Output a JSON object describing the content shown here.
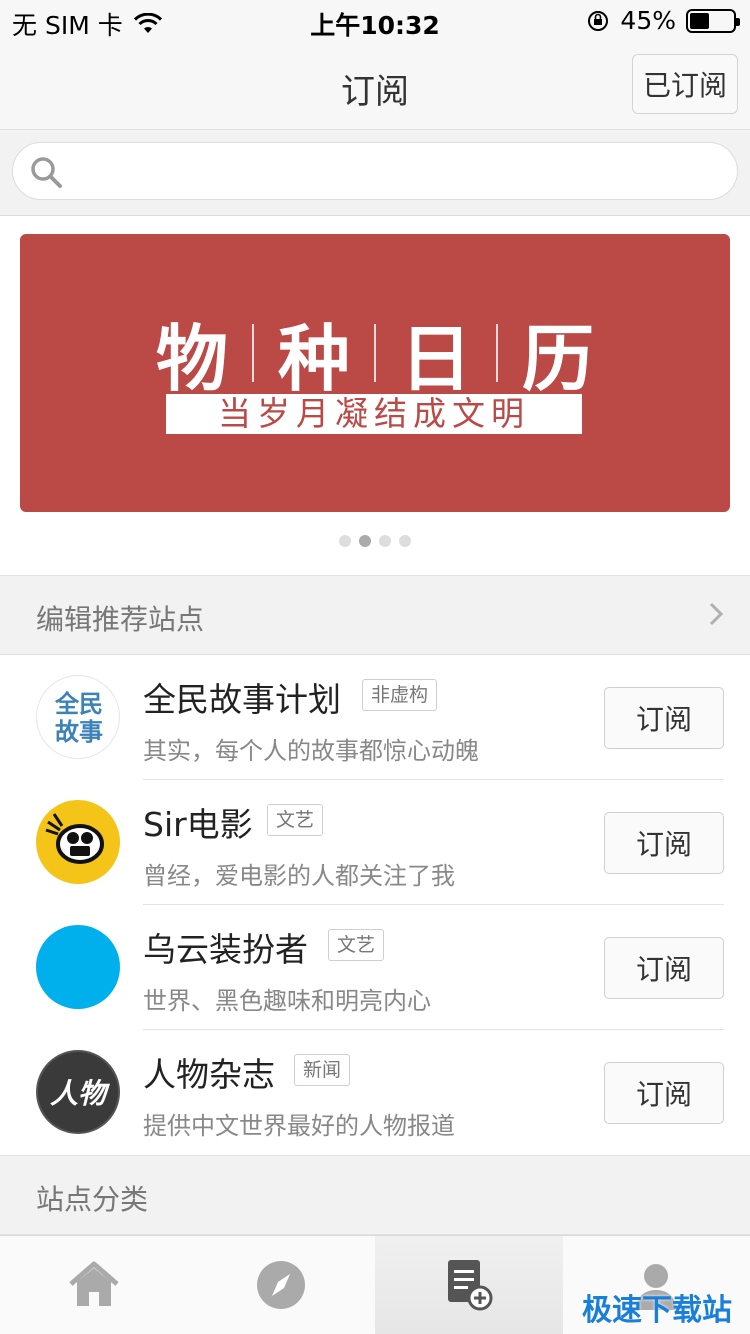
{
  "status_bar": {
    "carrier": "无 SIM 卡",
    "time": "上午10:32",
    "battery": "45%",
    "battery_level": 0.45
  },
  "nav": {
    "title": "订阅",
    "subscribed_label": "已订阅"
  },
  "search": {
    "placeholder": ""
  },
  "banner": {
    "title_chars": [
      "物",
      "种",
      "日",
      "历"
    ],
    "subtitle": "当岁月凝结成文明",
    "background": "#bb4a47",
    "page_count": 4,
    "active_page": 2
  },
  "recommended": {
    "header": "编辑推荐站点",
    "items": [
      {
        "name": "全民故事计划",
        "tag": "非虚构",
        "desc": "其实，每个人的故事都惊心动魄",
        "button": "订阅",
        "avatar_text": "全民故事",
        "avatar_icon": "story-logo-icon"
      },
      {
        "name": "Sir电影",
        "tag": "文艺",
        "desc": "曾经，爱电影的人都关注了我",
        "button": "订阅",
        "avatar_icon": "film-camera-icon"
      },
      {
        "name": "乌云装扮者",
        "tag": "文艺",
        "desc": "世界、黑色趣味和明亮内心",
        "button": "订阅",
        "avatar_icon": "blue-circle-icon"
      },
      {
        "name": "人物杂志",
        "tag": "新闻",
        "desc": "提供中文世界最好的人物报道",
        "button": "订阅",
        "avatar_text": "人物",
        "avatar_icon": "magazine-logo-icon"
      }
    ]
  },
  "categories": {
    "header": "站点分类"
  },
  "tab_bar": {
    "tabs": [
      "home-icon",
      "compass-icon",
      "subscribe-add-icon",
      "profile-icon"
    ],
    "active_index": 2
  },
  "watermark": "极速下载站",
  "colors": {
    "accent": "#bb4a47",
    "avatar_blue": "#00b0ec",
    "avatar_yellow": "#f4c518"
  }
}
